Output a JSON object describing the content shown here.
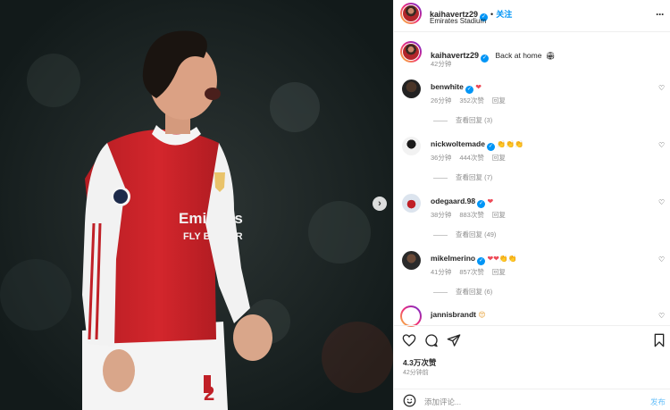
{
  "header": {
    "username": "kaihavertz29",
    "separator": "•",
    "follow_label": "关注",
    "location": "Emirates Stadium",
    "more_icon": "more-horizontal-icon"
  },
  "caption": {
    "username": "kaihavertz29",
    "text": "Back at home",
    "emoji": "🏟",
    "time": "42分钟"
  },
  "comments": [
    {
      "username": "benwhite",
      "emoji": "❤",
      "time": "26分钟",
      "likes": "352次赞",
      "reply_label": "回复",
      "view_replies": "查看回复 (3)"
    },
    {
      "username": "nickwoltemade",
      "emoji": "👏👏👏",
      "time": "36分钟",
      "likes": "444次赞",
      "reply_label": "回复",
      "view_replies": "查看回复 (7)"
    },
    {
      "username": "odegaard.98",
      "emoji": "❤",
      "time": "38分钟",
      "likes": "883次赞",
      "reply_label": "回复",
      "view_replies": "查看回复 (49)"
    },
    {
      "username": "mikelmerino",
      "emoji": "❤❤👏👏",
      "time": "41分钟",
      "likes": "857次赞",
      "reply_label": "回复",
      "view_replies": "查看回复 (6)"
    },
    {
      "username": "jannisbrandt",
      "emoji": "😍"
    }
  ],
  "actions": {
    "like_icon": "heart-icon",
    "comment_icon": "comment-icon",
    "share_icon": "send-icon",
    "save_icon": "bookmark-icon",
    "likes": "4.3万次赞",
    "time": "42分钟前"
  },
  "add_comment": {
    "placeholder": "添加评论...",
    "post_label": "发布",
    "emoji_icon": "smiley-icon"
  },
  "photo": {
    "badge_text": "Emirates",
    "badge_text2": "FLY BETTER",
    "shirt_number": "2",
    "next_icon": "chevron-right-icon"
  },
  "colors": {
    "accent": "#0095f6",
    "like_red": "#ed4956",
    "kit_red": "#d3262c"
  }
}
